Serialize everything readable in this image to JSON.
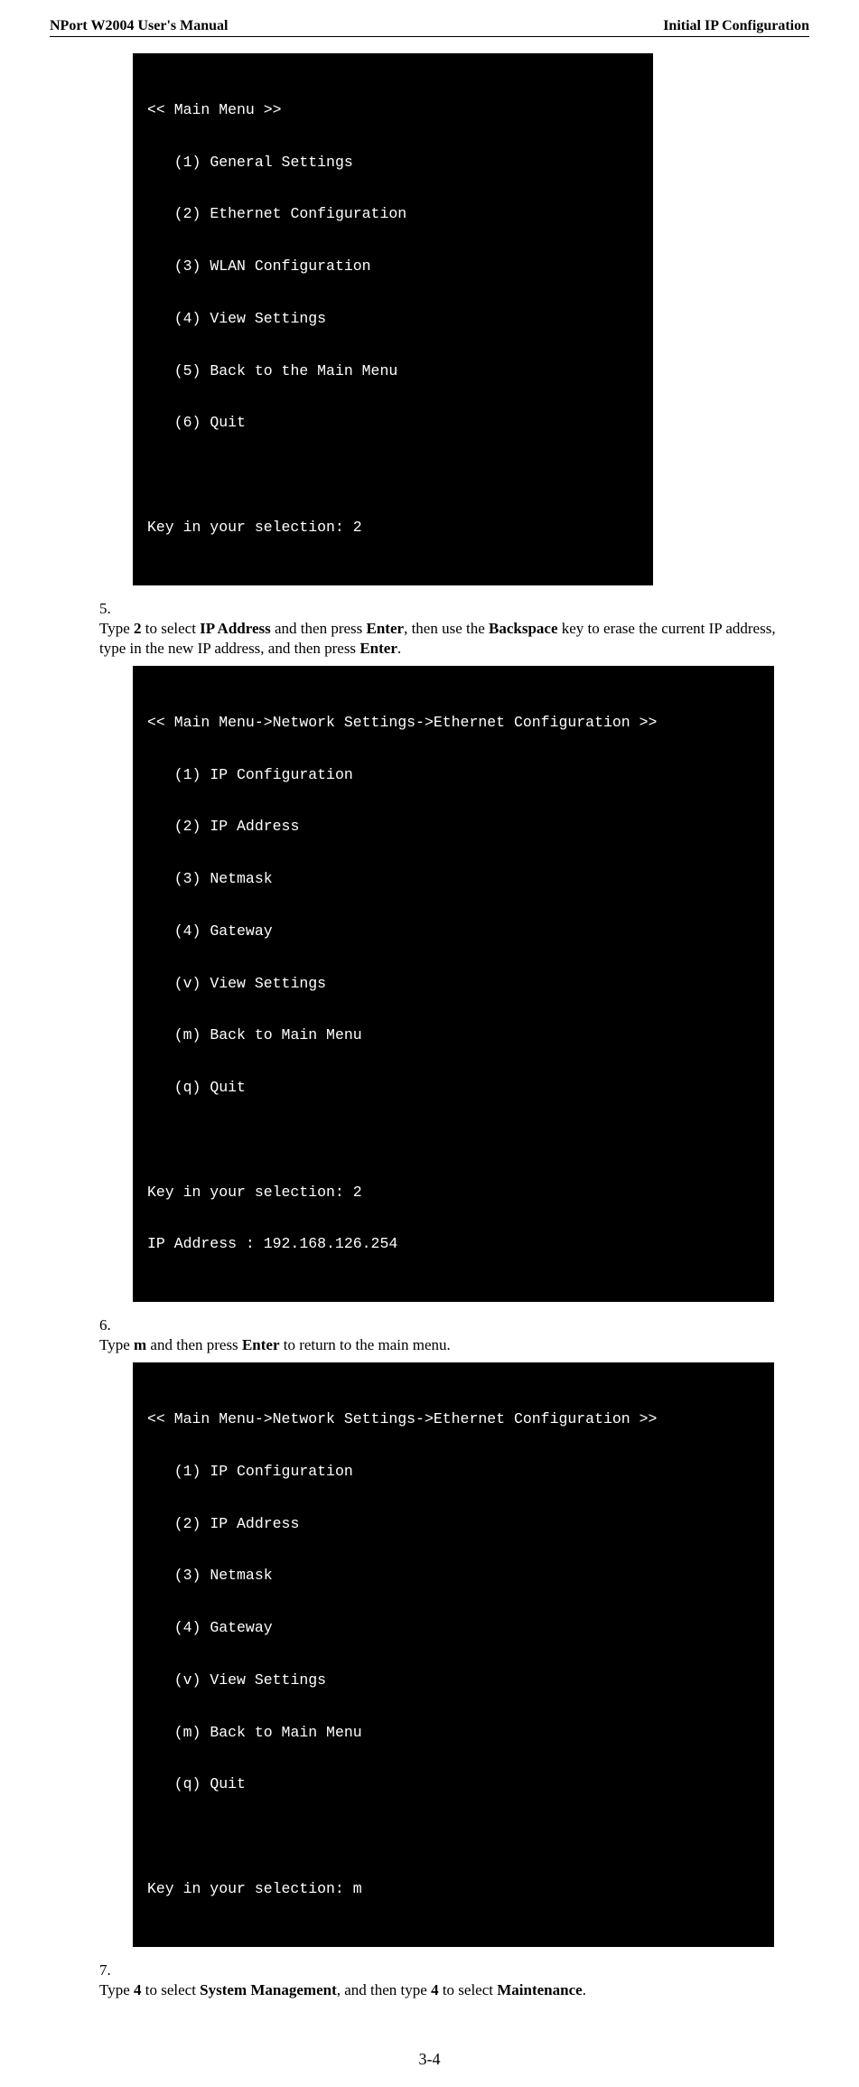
{
  "header": {
    "left": "NPort W2004 User's Manual",
    "right": "Initial IP Configuration"
  },
  "terminal1": {
    "title": "<< Main Menu >>",
    "items": [
      "(1) General Settings",
      "(2) Ethernet Configuration",
      "(3) WLAN Configuration",
      "(4) View Settings",
      "(5) Back to the Main Menu",
      "(6) Quit"
    ],
    "prompt": "Key in your selection: 2"
  },
  "step5": {
    "num": "5.",
    "pre1": "Type ",
    "b1": "2",
    "mid1": " to select ",
    "b2": "IP Address",
    "mid2": " and then press ",
    "b3": "Enter",
    "mid3": ", then use the ",
    "b4": "Backspace",
    "mid4": " key to erase the current IP address, type in the new IP address, and then press ",
    "b5": "Enter",
    "post": "."
  },
  "terminal2": {
    "title": "<< Main Menu->Network Settings->Ethernet Configuration >>",
    "items": [
      "(1) IP Configuration",
      "(2) IP Address",
      "(3) Netmask",
      "(4) Gateway",
      "(v) View Settings",
      "(m) Back to Main Menu",
      "(q) Quit"
    ],
    "prompt": "Key in your selection: 2",
    "extra": "IP Address : 192.168.126.254"
  },
  "step6": {
    "num": "6.",
    "pre1": "Type ",
    "b1": "m",
    "mid1": " and then press ",
    "b2": "Enter",
    "post": " to return to the main menu."
  },
  "terminal3": {
    "title": "<< Main Menu->Network Settings->Ethernet Configuration >>",
    "items": [
      "(1) IP Configuration",
      "(2) IP Address",
      "(3) Netmask",
      "(4) Gateway",
      "(v) View Settings",
      "(m) Back to Main Menu",
      "(q) Quit"
    ],
    "prompt": "Key in your selection: m"
  },
  "step7": {
    "num": "7.",
    "pre1": "Type ",
    "b1": "4",
    "mid1": " to select ",
    "b2": "System Management",
    "mid2": ", and then type ",
    "b3": "4",
    "mid3": " to select ",
    "b4": "Maintenance",
    "post": "."
  },
  "pagenum": "3-4"
}
